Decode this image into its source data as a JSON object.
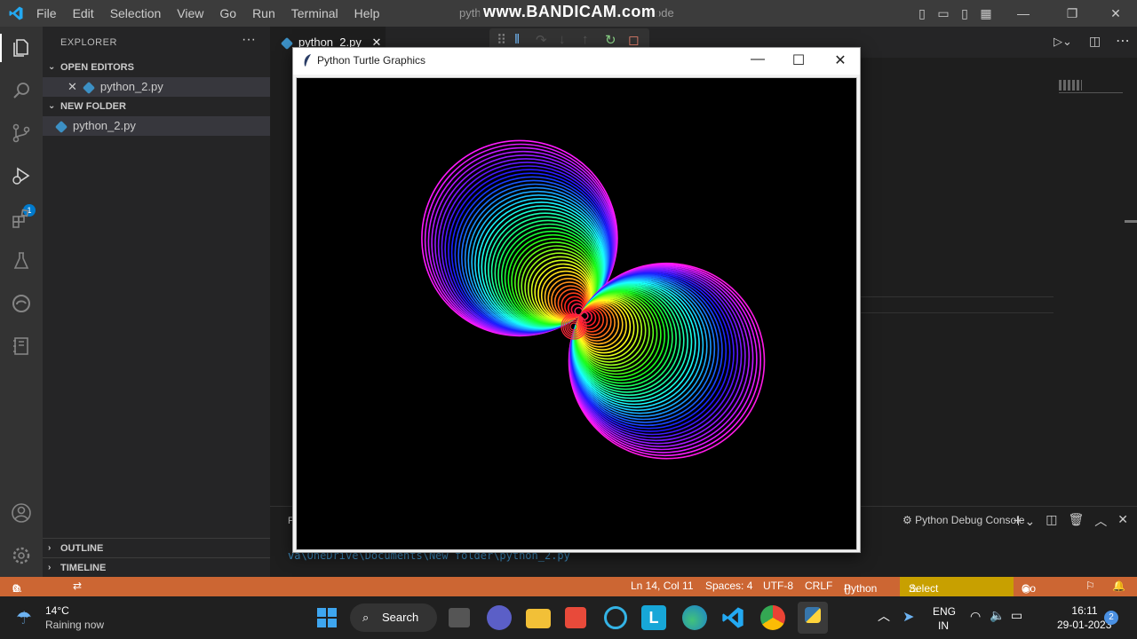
{
  "titlebar": {
    "menu": [
      "File",
      "Edit",
      "Selection",
      "View",
      "Go",
      "Run",
      "Terminal",
      "Help"
    ],
    "doc_title_left": "pyth",
    "doc_title_right": "ode",
    "watermark": "www.BANDICAM.com"
  },
  "activity": {
    "icons": [
      "explorer-icon",
      "search-icon",
      "source-control-icon",
      "run-debug-icon",
      "extensions-icon",
      "testing-icon",
      "edge-icon",
      "notebook-icon",
      "account-icon",
      "settings-gear-icon"
    ],
    "debug_badge": "1"
  },
  "sidebar": {
    "header": "EXPLORER",
    "more": "···",
    "open_editors": "OPEN EDITORS",
    "open_file": "python_2.py",
    "folder": "NEW FOLDER",
    "folder_file": "python_2.py",
    "outline": "OUTLINE",
    "timeline": "TIMELINE"
  },
  "tabs": {
    "active": "python_2.py",
    "close": "✕"
  },
  "panel": {
    "console_label": "Python Debug Console",
    "terminal_prefix": "F",
    "terminal_line": "va\\OneDrive\\Documents\\New folder\\python_2.py"
  },
  "turtle": {
    "title": "Python Turtle Graphics",
    "minimize": "—",
    "maximize": "☐",
    "close": "✕"
  },
  "status": {
    "errors": "0",
    "warnings": "0",
    "position": "Ln 14, Col 11",
    "spaces": "Spaces: 4",
    "encoding": "UTF-8",
    "eol": "CRLF",
    "language": "Python",
    "interpreter": "Select Interpreter",
    "golive": "Go Live",
    "colors": {
      "bar": "#cc6633",
      "interpreter": "#c8a000"
    }
  },
  "taskbar": {
    "temp": "14°C",
    "weather": "Raining now",
    "search": "Search",
    "lang_top": "ENG",
    "lang_bottom": "IN",
    "time": "16:11",
    "date": "29-01-2023",
    "notifications": "2"
  }
}
